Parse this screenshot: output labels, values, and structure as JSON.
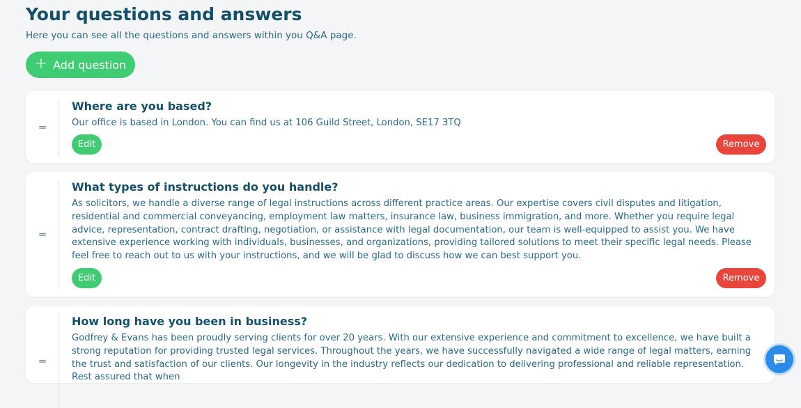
{
  "header": {
    "title": "Your questions and answers",
    "subtitle": "Here you can see all the questions and answers within you Q&A page."
  },
  "toolbar": {
    "add_label": "Add question",
    "add_icon": "plus-icon"
  },
  "qa_items": [
    {
      "question": "Where are you based?",
      "answer": "Our office is based in London. You can find us at 106 Guild Street, London, SE17 3TQ",
      "edit_label": "Edit",
      "remove_label": "Remove",
      "handle_glyph": "═"
    },
    {
      "question": "What types of instructions do you handle?",
      "answer": "As solicitors, we handle a diverse range of legal instructions across different practice areas. Our expertise covers civil disputes and litigation, residential and commercial conveyancing, employment law matters, insurance law, business immigration, and more. Whether you require legal advice, representation, contract drafting, negotiation, or assistance with legal documentation, our team is well-equipped to assist you. We have extensive experience working with individuals, businesses, and organizations, providing tailored solutions to meet their specific legal needs. Please feel free to reach out to us with your instructions, and we will be glad to discuss how we can best support you.",
      "edit_label": "Edit",
      "remove_label": "Remove",
      "handle_glyph": "═"
    },
    {
      "question": "How long have you been in business?",
      "answer": "Godfrey & Evans has been proudly serving clients for over 20 years. With our extensive experience and commitment to excellence, we have built a strong reputation for providing trusted legal services. Throughout the years, we have successfully navigated a wide range of legal matters, earning the trust and satisfaction of our clients. Our longevity in the industry reflects our dedication to delivering professional and reliable representation. Rest assured that when",
      "handle_glyph": "═"
    }
  ],
  "colors": {
    "accent_green": "#3fcc72",
    "danger_red": "#e8453c",
    "heading": "#145068",
    "text": "#2b6a83",
    "chat_blue": "#2c8be8"
  },
  "chat_widget": {
    "icon": "chat-icon"
  }
}
